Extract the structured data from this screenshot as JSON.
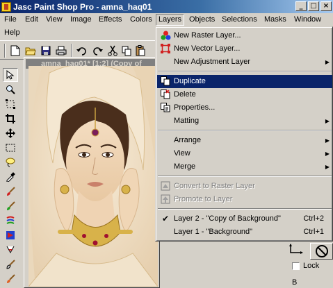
{
  "window": {
    "title": "Jasc Paint Shop Pro - amna_haq01",
    "minimize": "_",
    "maximize": "□",
    "close": "×"
  },
  "menubar": {
    "items": [
      "File",
      "Edit",
      "View",
      "Image",
      "Effects",
      "Colors",
      "Layers",
      "Objects",
      "Selections",
      "Masks",
      "Window",
      "Help"
    ],
    "active": "Layers"
  },
  "image_window": {
    "title": "amna_haq01* [1:2] (Copy of"
  },
  "layers_menu": {
    "items": [
      {
        "label": "New Raster Layer...",
        "icon": "new-raster-layer-icon"
      },
      {
        "label": "New Vector Layer...",
        "icon": "new-vector-layer-icon"
      },
      {
        "label": "New Adjustment Layer",
        "submenu": true
      },
      {
        "label": "Duplicate",
        "icon": "duplicate-icon",
        "highlighted": true
      },
      {
        "label": "Delete",
        "icon": "delete-layer-icon"
      },
      {
        "label": "Properties...",
        "icon": "properties-icon"
      },
      {
        "label": "Matting",
        "submenu": true
      },
      {
        "label": "Arrange",
        "submenu": true
      },
      {
        "label": "View",
        "submenu": true
      },
      {
        "label": "Merge",
        "submenu": true
      },
      {
        "label": "Convert to Raster Layer",
        "icon": "convert-raster-icon",
        "disabled": true
      },
      {
        "label": "Promote to Layer",
        "icon": "promote-layer-icon",
        "disabled": true
      },
      {
        "label": "Layer 2 - \"Copy of Background\"",
        "shortcut": "Ctrl+2",
        "checked": true
      },
      {
        "label": "Layer 1 - \"Background\"",
        "shortcut": "Ctrl+1"
      }
    ]
  },
  "right_panel": {
    "lock_label": "Lock",
    "b_label": "B"
  },
  "colors": {
    "titlebar_start": "#0a246a",
    "titlebar_end": "#a6caf0",
    "highlight": "#0a246a",
    "face": "#d4d0c8"
  }
}
